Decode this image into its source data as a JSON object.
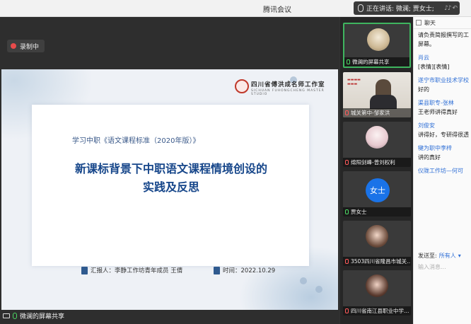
{
  "window": {
    "title": "腾讯会议",
    "speaking_label": "正在讲话: 微澜; 贾女士;"
  },
  "stage": {
    "recording_label": "录制中",
    "sharer_label": "微澜的屏幕共享"
  },
  "slide": {
    "logo_text": "四川省傅洪成名师工作室",
    "logo_sub": "SICHUAN FUHONGCHENG MASTER STUDIO",
    "subtitle": "学习中职《语文课程标准（2020年版）》",
    "title_line1": "新课标背景下中职语文课程情境创设的",
    "title_line2": "实践及反思",
    "reporter": "汇报人：李静工作坊青年成员   王倩",
    "time": "时间：2022.10.29"
  },
  "participants": [
    {
      "name": "微澜的屏幕共享",
      "mic": "on",
      "active": true
    },
    {
      "name": "城关第中-邹家洪",
      "mic": "off",
      "active": false
    },
    {
      "name": "绵阳剑峰-曾刘权利",
      "mic": "off",
      "active": false
    },
    {
      "name": "贾女士",
      "mic": "on",
      "avatar_text": "女士",
      "active": false
    },
    {
      "name": "3503四川省隆昌市城关…",
      "mic": "off",
      "active": false
    },
    {
      "name": "四川省南江县职业中学…",
      "mic": "off",
      "active": false
    }
  ],
  "chat": {
    "header": "聊天",
    "messages": [
      {
        "type": "text",
        "text": "请负责简报撰写的工"
      },
      {
        "type": "text",
        "text": "屏幕。"
      },
      {
        "type": "name",
        "text": "肖云"
      },
      {
        "type": "text",
        "text": "[表情][表情]"
      },
      {
        "type": "name",
        "text": "遂宁市职业技术学校"
      },
      {
        "type": "text",
        "text": "好的"
      },
      {
        "type": "name",
        "text": "渠县职专-张林"
      },
      {
        "type": "text",
        "text": "王老师讲得真好"
      },
      {
        "type": "name",
        "text": "刘俊安"
      },
      {
        "type": "text",
        "text": "讲得好，专研得很透"
      },
      {
        "type": "name",
        "text": "犍为职中李梓"
      },
      {
        "type": "text",
        "text": "讲的真好"
      },
      {
        "type": "name",
        "text": "仪陇工作坊—何可"
      }
    ],
    "send_to_label": "发送至:",
    "send_to_value": "所有人",
    "input_placeholder": "输入消息..."
  }
}
